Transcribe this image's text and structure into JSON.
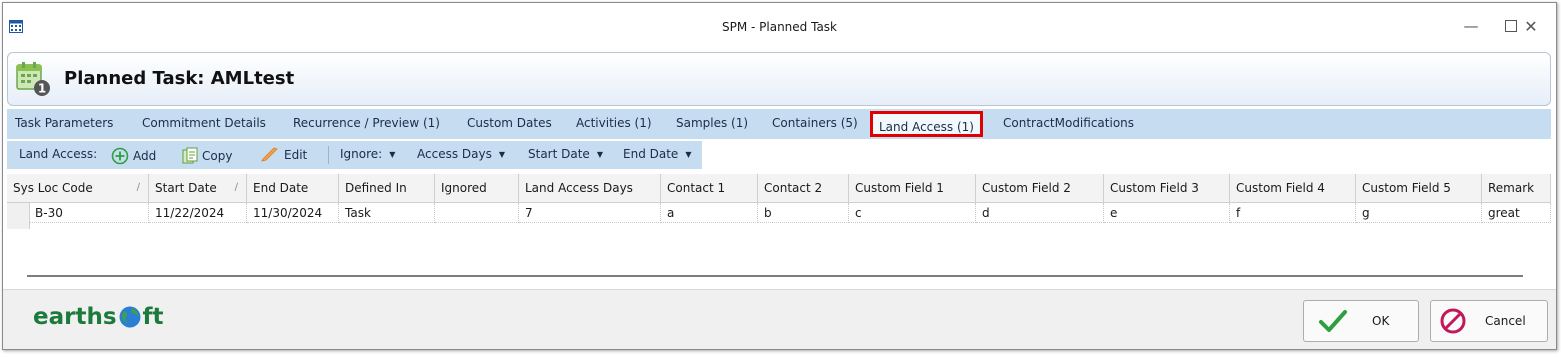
{
  "window": {
    "title": "SPM - Planned Task",
    "controls": [
      "minimize-icon",
      "maximize-icon",
      "close-icon"
    ]
  },
  "header": {
    "title": "Planned Task:  AMLtest"
  },
  "tabs": [
    {
      "label": "Task Parameters"
    },
    {
      "label": "Commitment Details"
    },
    {
      "label": "Recurrence / Preview (1)"
    },
    {
      "label": "Custom Dates"
    },
    {
      "label": "Activities (1)"
    },
    {
      "label": "Samples (1)"
    },
    {
      "label": "Containers (5)"
    },
    {
      "label": "Land Access (1)",
      "selected": true
    },
    {
      "label": "ContractModifications"
    }
  ],
  "toolbar": {
    "section_label": "Land Access:",
    "add_label": "Add",
    "copy_label": "Copy",
    "edit_label": "Edit",
    "ignore_label": "Ignore:",
    "access_days_label": "Access Days",
    "start_date_label": "Start Date",
    "end_date_label": "End Date"
  },
  "grid": {
    "columns": [
      "Sys Loc Code",
      "Start Date",
      "End Date",
      "Defined In",
      "Ignored",
      "Land Access Days",
      "Contact 1",
      "Contact 2",
      "Custom Field 1",
      "Custom Field 2",
      "Custom Field 3",
      "Custom Field 4",
      "Custom Field 5",
      "Remark"
    ],
    "rows": [
      [
        "B-30",
        "11/22/2024",
        "11/30/2024",
        "Task",
        "",
        "7",
        "a",
        "b",
        "c",
        "d",
        "e",
        "f",
        "g",
        "great"
      ]
    ]
  },
  "footer": {
    "logo_text_left": "earths",
    "logo_text_right": "ft",
    "ok_label": "OK",
    "cancel_label": "Cancel"
  },
  "colors": {
    "tab_strip": "#c6dcf1",
    "active_tab_outline": "#e00000",
    "logo_green": "#1c7a3c",
    "ok_check": "#2e9e3e",
    "cancel_icon": "#c2185b"
  }
}
